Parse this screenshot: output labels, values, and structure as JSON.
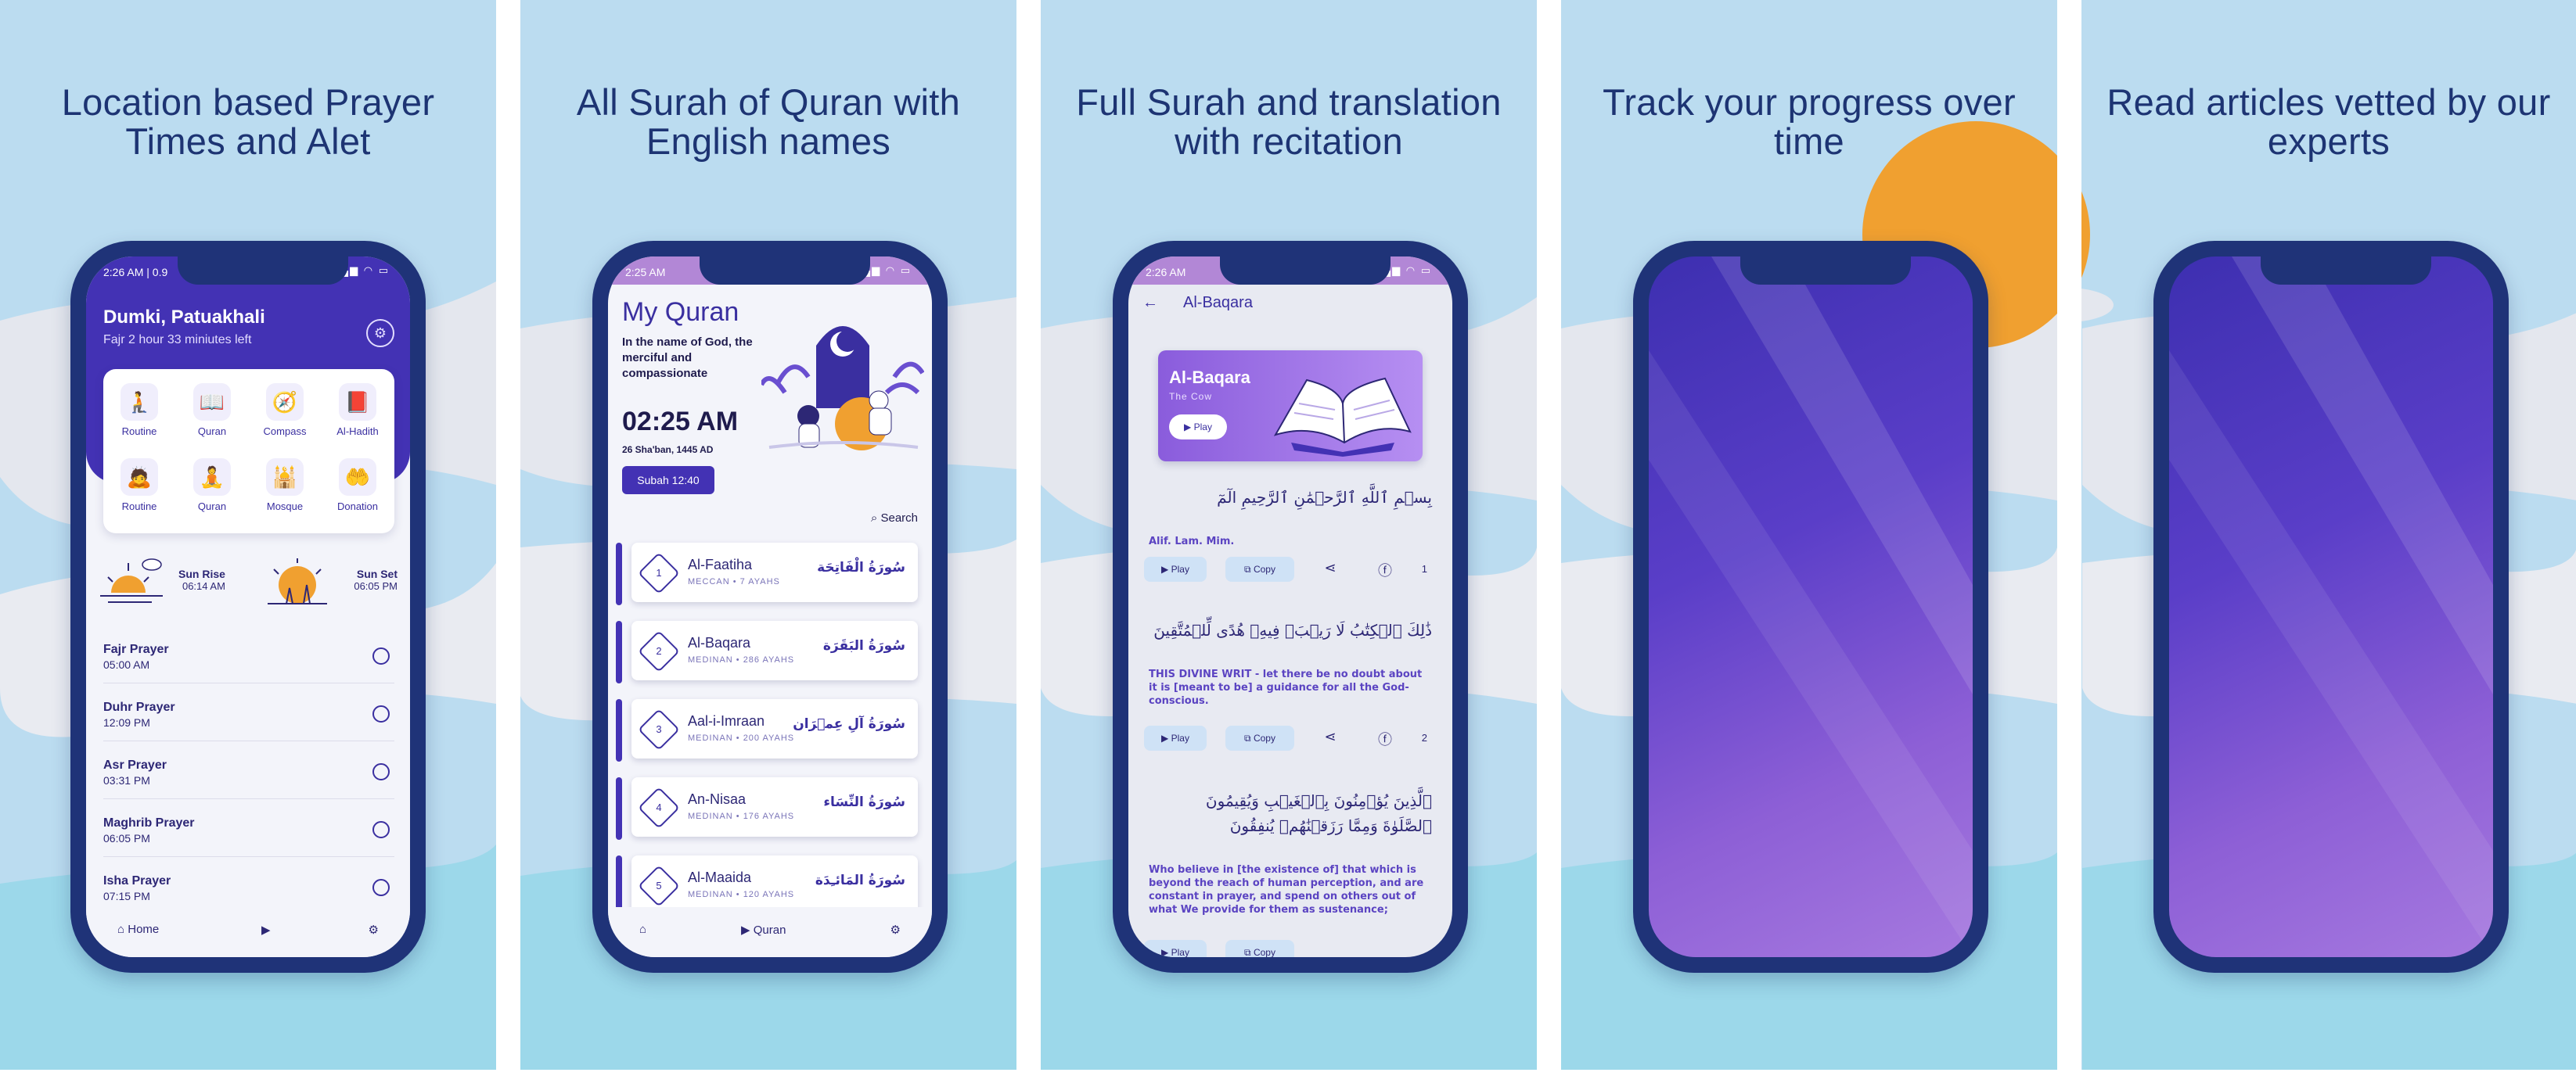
{
  "colors": {
    "sky": "#bbdcf0",
    "deep_navy": "#1f3378",
    "primary": "#4332b4",
    "sun": "#f0a030",
    "sea": "#9cd8ea"
  },
  "panels": [
    {
      "headline": "Location based Prayer Times and Alet"
    },
    {
      "headline": "All Surah of Quran with English names"
    },
    {
      "headline": "Full Surah and translation with recitation"
    },
    {
      "headline": "Track your progress over time"
    },
    {
      "headline": "Read articles vetted by our experts"
    }
  ],
  "prayer_screen": {
    "status_time": "2:26 AM | 0.9",
    "city": "Dumki, Patuakhali",
    "time_left": "Fajr 2 hour 33 miniutes left",
    "grid": [
      {
        "label": "Routine",
        "icon": "prayer-person-icon"
      },
      {
        "label": "Quran",
        "icon": "quran-book-icon"
      },
      {
        "label": "Compass",
        "icon": "compass-icon"
      },
      {
        "label": "Al-Hadith",
        "icon": "hadith-book-icon"
      },
      {
        "label": "Routine",
        "icon": "prostrate-icon"
      },
      {
        "label": "Quran",
        "icon": "reading-person-icon"
      },
      {
        "label": "Mosque",
        "icon": "mosque-person-icon"
      },
      {
        "label": "Donation",
        "icon": "donation-icon"
      }
    ],
    "sunrise": {
      "label": "Sun Rise",
      "time": "06:14 AM"
    },
    "sunset": {
      "label": "Sun Set",
      "time": "06:05 PM"
    },
    "prayers": [
      {
        "name": "Fajr Prayer",
        "time": "05:00 AM"
      },
      {
        "name": "Duhr Prayer",
        "time": "12:09 PM"
      },
      {
        "name": "Asr Prayer",
        "time": "03:31 PM"
      },
      {
        "name": "Maghrib Prayer",
        "time": "06:05 PM"
      },
      {
        "name": "Isha Prayer",
        "time": "07:15 PM"
      }
    ],
    "nav": {
      "home": "Home"
    }
  },
  "quran_screen": {
    "status_time": "2:25 AM",
    "title": "My Quran",
    "subtitle": "In the name of God, the merciful and compassionate",
    "clock": "02:25 AM",
    "date": "26 Sha'ban, 1445 AD",
    "subah": "Subah 12:40",
    "search": "Search",
    "surahs": [
      {
        "num": "1",
        "name": "Al-Faatiha",
        "meta": "MECCAN • 7 AYAHS",
        "arabic": "سُورَةُ الْفَاتِحَة"
      },
      {
        "num": "2",
        "name": "Al-Baqara",
        "meta": "MEDINAN • 286 AYAHS",
        "arabic": "سُورَةُ البَقَرَة"
      },
      {
        "num": "3",
        "name": "Aal-i-Imraan",
        "meta": "MEDINAN • 200 AYAHS",
        "arabic": "سُورَةُ آلِ عِمۡرَان"
      },
      {
        "num": "4",
        "name": "An-Nisaa",
        "meta": "MEDINAN • 176 AYAHS",
        "arabic": "سُورَةُ النِّسَاء"
      },
      {
        "num": "5",
        "name": "Al-Maaida",
        "meta": "MEDINAN • 120 AYAHS",
        "arabic": "سُورَةُ المَائـِدَة"
      }
    ],
    "nav": {
      "quran": "Quran"
    }
  },
  "surah_screen": {
    "status_time": "2:26 AM",
    "title": "Al-Baqara",
    "banner": {
      "title": "Al-Baqara",
      "subtitle": "The Cow",
      "play": "Play"
    },
    "verses": [
      {
        "arabic": "بِسۡمِ ٱللَّهِ ٱلرَّحۡمَٰنِ ٱلرَّحِيمِ الٓمٓ",
        "translation": "Alif. Lam. Mim.",
        "num": "1"
      },
      {
        "arabic": "ذَٰلِكَ ٱلۡكِتَٰبُ لَا رَيۡبَۛ فِيهِۛ هُدًى لِّلۡمُتَّقِينَ",
        "translation": "THIS DIVINE WRIT - let there be no doubt about it is [meant to be] a guidance for all the God-conscious.",
        "num": "2"
      },
      {
        "arabic": "ٱلَّذِينَ يُؤۡمِنُونَ بِٱلۡغَيۡبِ وَيُقِيمُونَ ٱلصَّلَوٰةَ وَمِمَّا رَزَقۡنَٰهُمۡ يُنفِقُونَ",
        "translation": "Who believe in [the existence of] that which is beyond the reach of human perception, and are constant in prayer, and spend on others out of what We provide for them as sustenance;",
        "num": ""
      }
    ],
    "actions": {
      "play": "Play",
      "copy": "Copy"
    }
  }
}
